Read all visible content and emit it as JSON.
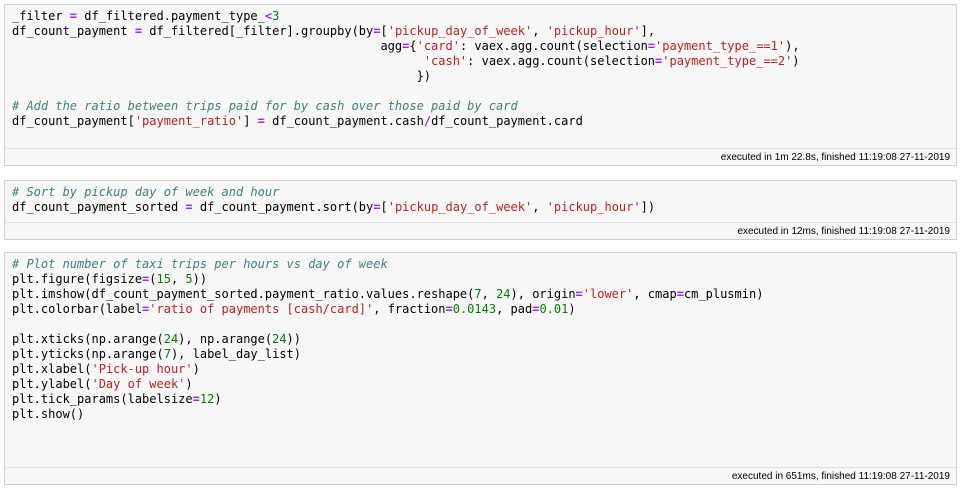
{
  "cells": [
    {
      "lines": [
        [
          [
            "n",
            "_filter "
          ],
          [
            "o",
            "="
          ],
          [
            "n",
            " df_filtered.payment_type_"
          ],
          [
            "o",
            "<"
          ],
          [
            "d",
            "3"
          ]
        ],
        [
          [
            "n",
            "df_count_payment "
          ],
          [
            "o",
            "="
          ],
          [
            "n",
            " df_filtered[_filter].groupby(by"
          ],
          [
            "o",
            "="
          ],
          [
            "n",
            "["
          ],
          [
            "s",
            "'pickup_day_of_week'"
          ],
          [
            "n",
            ", "
          ],
          [
            "s",
            "'pickup_hour'"
          ],
          [
            "n",
            "],"
          ]
        ],
        [
          [
            "n",
            "                                                   agg"
          ],
          [
            "o",
            "="
          ],
          [
            "n",
            "{"
          ],
          [
            "s",
            "'card'"
          ],
          [
            "n",
            ": vaex.agg.count(selection"
          ],
          [
            "o",
            "="
          ],
          [
            "s",
            "'payment_type_==1'"
          ],
          [
            "n",
            "),"
          ]
        ],
        [
          [
            "n",
            "                                                         "
          ],
          [
            "s",
            "'cash'"
          ],
          [
            "n",
            ": vaex.agg.count(selection"
          ],
          [
            "o",
            "="
          ],
          [
            "s",
            "'payment_type_==2'"
          ],
          [
            "n",
            ")"
          ]
        ],
        [
          [
            "n",
            "                                                        })"
          ]
        ],
        [
          [
            "n",
            ""
          ]
        ],
        [
          [
            "c",
            "# Add the ratio between trips paid for by cash over those paid by card"
          ]
        ],
        [
          [
            "n",
            "df_count_payment["
          ],
          [
            "s",
            "'payment_ratio'"
          ],
          [
            "n",
            "] "
          ],
          [
            "o",
            "="
          ],
          [
            "n",
            " df_count_payment.cash"
          ],
          [
            "o",
            "/"
          ],
          [
            "n",
            "df_count_payment.card"
          ]
        ]
      ],
      "status": "executed in 1m 22.8s, finished 11:19:08 27-11-2019"
    },
    {
      "lines": [
        [
          [
            "c",
            "# Sort by pickup day of week and hour"
          ]
        ],
        [
          [
            "n",
            "df_count_payment_sorted "
          ],
          [
            "o",
            "="
          ],
          [
            "n",
            " df_count_payment.sort(by"
          ],
          [
            "o",
            "="
          ],
          [
            "n",
            "["
          ],
          [
            "s",
            "'pickup_day_of_week'"
          ],
          [
            "n",
            ", "
          ],
          [
            "s",
            "'pickup_hour'"
          ],
          [
            "n",
            "])"
          ]
        ]
      ],
      "status": "executed in 12ms, finished 11:19:08 27-11-2019"
    },
    {
      "lines": [
        [
          [
            "c",
            "# Plot number of taxi trips per hours vs day of week"
          ]
        ],
        [
          [
            "n",
            "plt.figure(figsize"
          ],
          [
            "o",
            "="
          ],
          [
            "n",
            "("
          ],
          [
            "d",
            "15"
          ],
          [
            "n",
            ", "
          ],
          [
            "d",
            "5"
          ],
          [
            "n",
            "))"
          ]
        ],
        [
          [
            "n",
            "plt.imshow(df_count_payment_sorted.payment_ratio.values.reshape("
          ],
          [
            "d",
            "7"
          ],
          [
            "n",
            ", "
          ],
          [
            "d",
            "24"
          ],
          [
            "n",
            "), origin"
          ],
          [
            "o",
            "="
          ],
          [
            "s",
            "'lower'"
          ],
          [
            "n",
            ", cmap"
          ],
          [
            "o",
            "="
          ],
          [
            "n",
            "cm_plusmin)"
          ]
        ],
        [
          [
            "n",
            "plt.colorbar(label"
          ],
          [
            "o",
            "="
          ],
          [
            "s",
            "'ratio of payments [cash/card]'"
          ],
          [
            "n",
            ", fraction"
          ],
          [
            "o",
            "="
          ],
          [
            "d",
            "0.0143"
          ],
          [
            "n",
            ", pad"
          ],
          [
            "o",
            "="
          ],
          [
            "d",
            "0.01"
          ],
          [
            "n",
            ")"
          ]
        ],
        [
          [
            "n",
            ""
          ]
        ],
        [
          [
            "n",
            "plt.xticks(np.arange("
          ],
          [
            "d",
            "24"
          ],
          [
            "n",
            "), np.arange("
          ],
          [
            "d",
            "24"
          ],
          [
            "n",
            "))"
          ]
        ],
        [
          [
            "n",
            "plt.yticks(np.arange("
          ],
          [
            "d",
            "7"
          ],
          [
            "n",
            "), label_day_list)"
          ]
        ],
        [
          [
            "n",
            "plt.xlabel("
          ],
          [
            "s",
            "'Pick-up hour'"
          ],
          [
            "n",
            ")"
          ]
        ],
        [
          [
            "n",
            "plt.ylabel("
          ],
          [
            "s",
            "'Day of week'"
          ],
          [
            "n",
            ")"
          ]
        ],
        [
          [
            "n",
            "plt.tick_params(labelsize"
          ],
          [
            "o",
            "="
          ],
          [
            "d",
            "12"
          ],
          [
            "n",
            ")"
          ]
        ],
        [
          [
            "n",
            "plt.show()"
          ]
        ]
      ],
      "status": "executed in 651ms, finished 11:19:08 27-11-2019"
    }
  ]
}
